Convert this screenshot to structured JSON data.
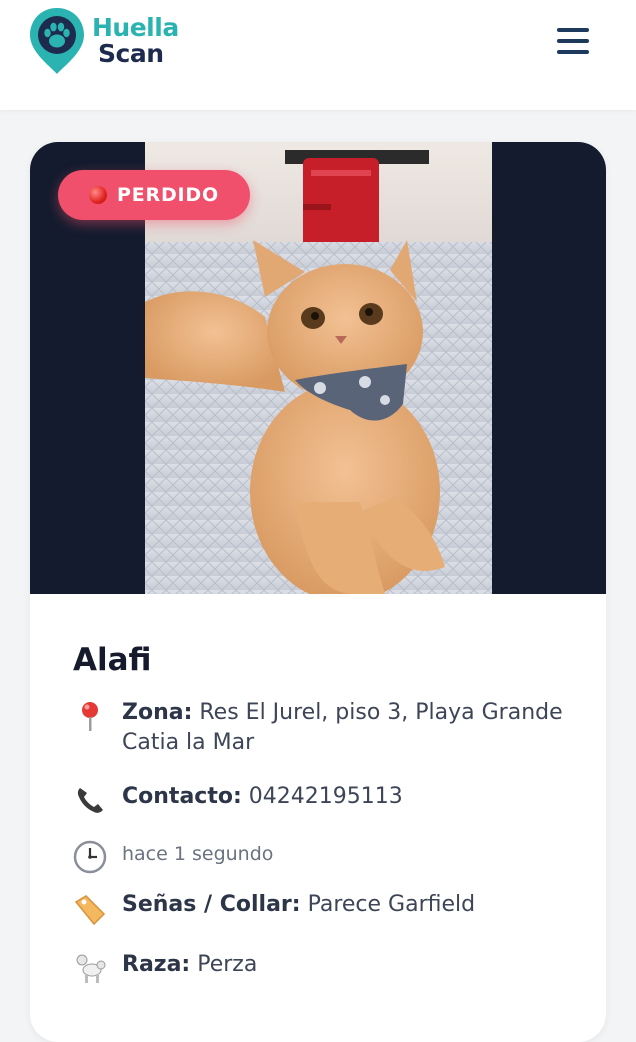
{
  "header": {
    "brand_line1": "Huella",
    "brand_line2": "Scan",
    "logo_icon": "paw-pin-icon",
    "menu_icon": "hamburger-menu-icon",
    "brand_color": "#2bb3b1",
    "brand_dark": "#1d2b4f"
  },
  "pet": {
    "status": "PERDIDO",
    "status_icon": "red-circle-icon",
    "status_color": "#f0506b",
    "name": "Alafi",
    "photo_alt": "Gato persa naranja con pañoleta"
  },
  "details": {
    "zone_label": "Zona:",
    "zone_value": "Res El Jurel, piso 3, Playa Grande Catia la Mar",
    "contact_label": "Contacto:",
    "contact_value": "04242195113",
    "time_value": "hace 1 segundo",
    "marks_label": "Señas / Collar:",
    "marks_value": "Parece Garfield",
    "breed_label": "Raza:",
    "breed_value": "Perza"
  }
}
